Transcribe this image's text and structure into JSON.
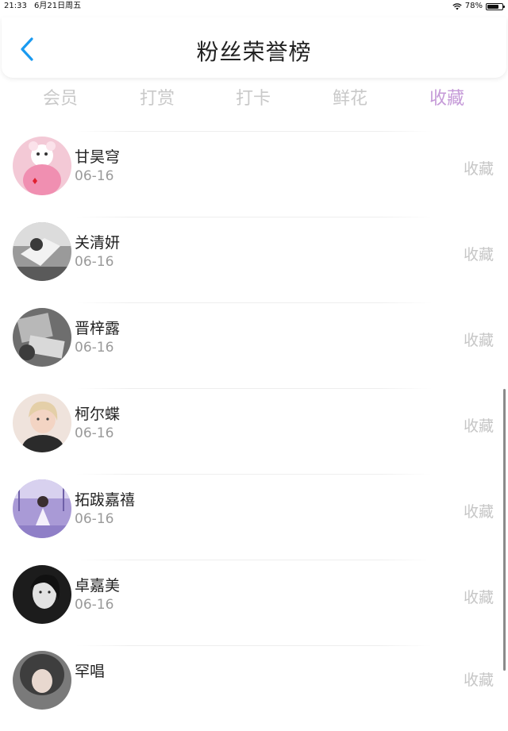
{
  "status_bar": {
    "time": "21:33",
    "date": "6月21日周五",
    "battery": "78%"
  },
  "header": {
    "title": "粉丝荣誉榜",
    "back_icon": "chevron-left-icon",
    "accent_color": "#1a9af0"
  },
  "tabs": [
    {
      "label": "会员",
      "active": false
    },
    {
      "label": "打赏",
      "active": false
    },
    {
      "label": "打卡",
      "active": false
    },
    {
      "label": "鲜花",
      "active": false
    },
    {
      "label": "收藏",
      "active": true
    }
  ],
  "active_tab_color": "#c59ad8",
  "fans": [
    {
      "name": "甘昊穹",
      "date": "06-16",
      "action": "收藏"
    },
    {
      "name": "关清妍",
      "date": "06-16",
      "action": "收藏"
    },
    {
      "name": "晋梓露",
      "date": "06-16",
      "action": "收藏"
    },
    {
      "name": "柯尔蝶",
      "date": "06-16",
      "action": "收藏"
    },
    {
      "name": "拓跋嘉禧",
      "date": "06-16",
      "action": "收藏"
    },
    {
      "name": "卓嘉美",
      "date": "06-16",
      "action": "收藏"
    },
    {
      "name": "罕唱",
      "date": "",
      "action": "收藏"
    }
  ]
}
